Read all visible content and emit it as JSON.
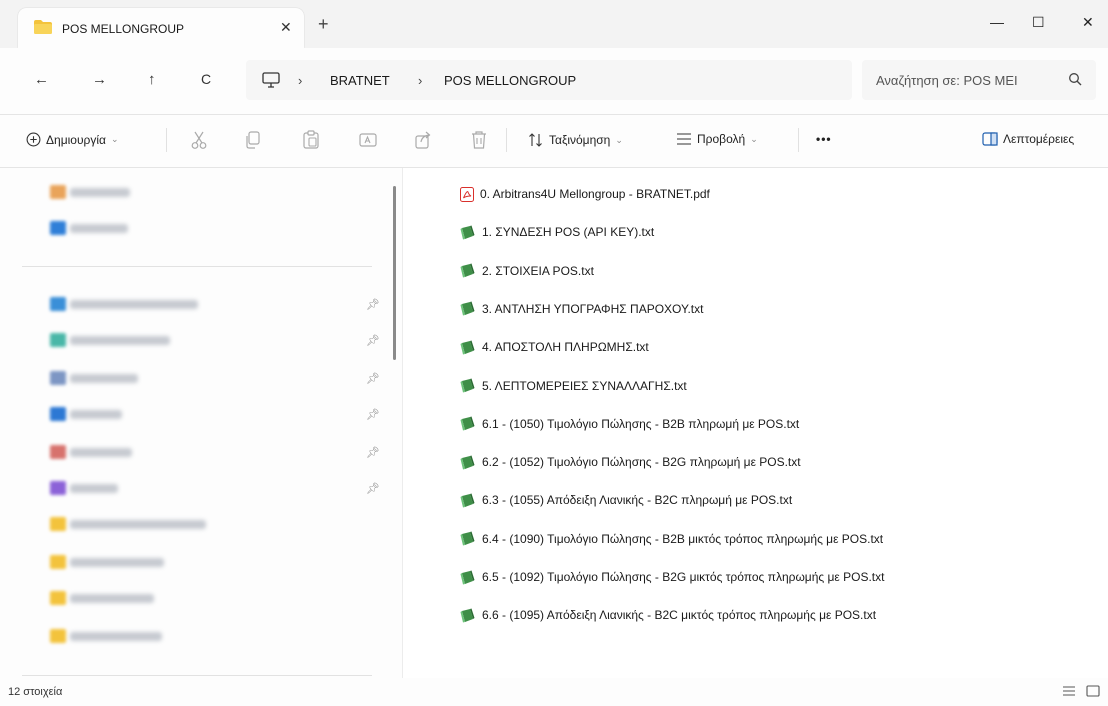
{
  "window": {
    "tab_title": "POS MELLONGROUP",
    "tab_close": "✕",
    "new_tab": "+",
    "minimize": "—",
    "maximize": "☐",
    "close": "✕"
  },
  "addressbar": {
    "back": "←",
    "forward": "→",
    "up": "↑",
    "refresh": "C",
    "separator": "›",
    "breadcrumbs": [
      "BRATNET",
      "POS MELLONGROUP"
    ],
    "search_placeholder": "Αναζήτηση σε: POS MEI"
  },
  "toolbar": {
    "new_label": "Δημιουργία",
    "sort_label": "Ταξινόμηση",
    "view_label": "Προβολή",
    "more_label": "•••",
    "details_label": "Λεπτομέρειες",
    "icons": [
      "cut-icon",
      "copy-icon",
      "paste-icon",
      "rename-icon",
      "share-icon",
      "delete-icon"
    ]
  },
  "files": [
    {
      "name": "0. Arbitrans4U Mellongroup - BRATNET.pdf",
      "type": "pdf"
    },
    {
      "name": "1. ΣΥΝΔΕΣΗ POS (API KEY).txt",
      "type": "txt"
    },
    {
      "name": "2. ΣΤΟΙΧΕΙΑ POS.txt",
      "type": "txt"
    },
    {
      "name": "3. ΑΝΤΛΗΣΗ ΥΠΟΓΡΑΦΗΣ ΠΑΡΟΧΟΥ.txt",
      "type": "txt"
    },
    {
      "name": "4. ΑΠΟΣΤΟΛΗ ΠΛΗΡΩΜΗΣ.txt",
      "type": "txt"
    },
    {
      "name": "5. ΛΕΠΤΟΜΕΡΕΙΕΣ ΣΥΝΑΛΛΑΓΗΣ.txt",
      "type": "txt"
    },
    {
      "name": "6.1 - (1050) Τιμολόγιο Πώλησης - B2B  πληρωμή με POS.txt",
      "type": "txt"
    },
    {
      "name": "6.2 - (1052) Τιμολόγιο Πώλησης - B2G πληρωμή με POS.txt",
      "type": "txt"
    },
    {
      "name": "6.3 - (1055) Απόδειξη Λιανικής - B2C πληρωμή με POS.txt",
      "type": "txt"
    },
    {
      "name": "6.4 - (1090) Τιμολόγιο Πώλησης - B2B μικτός τρόπος πληρωμής με POS.txt",
      "type": "txt"
    },
    {
      "name": "6.5 - (1092) Τιμολόγιο Πώλησης - B2G μικτός τρόπος πληρωμής με POS.txt",
      "type": "txt"
    },
    {
      "name": "6.6 - (1095) Απόδειξη Λιανικής - B2C μικτός τρόπος πληρωμής με POS.txt",
      "type": "txt"
    }
  ],
  "statusbar": {
    "item_count": "12 στοιχεία"
  },
  "colors": {
    "accent": "#0067c0",
    "pdf_red": "#d9302c",
    "txt_green": "#3f8f48",
    "folder_yellow": "#f3c33c"
  }
}
